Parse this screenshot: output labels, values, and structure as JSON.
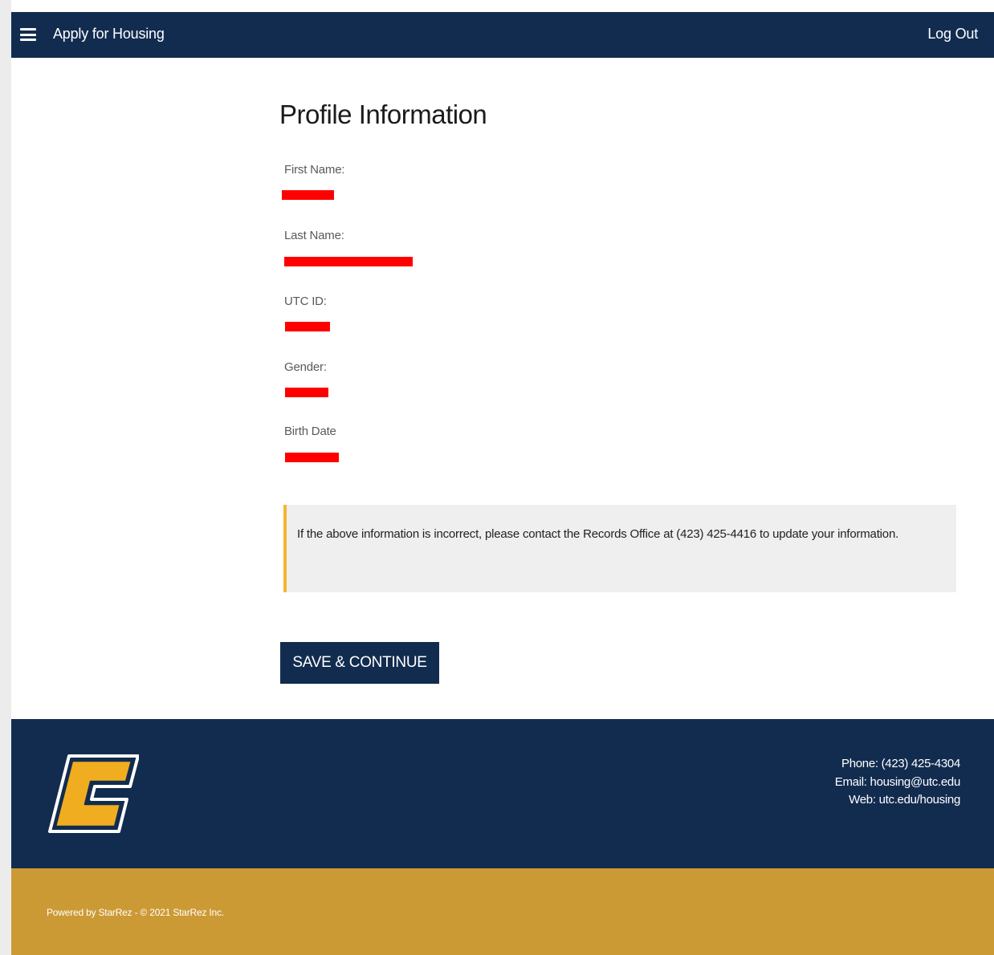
{
  "header": {
    "app_title": "Apply for Housing",
    "logout_label": "Log Out",
    "menu_icon": "hamburger-menu-icon"
  },
  "main": {
    "title": "Profile Information",
    "fields": [
      {
        "label": "First Name:"
      },
      {
        "label": "Last Name:"
      },
      {
        "label": "UTC ID:"
      },
      {
        "label": "Gender:"
      },
      {
        "label": "Birth Date"
      }
    ],
    "notice": "If the above information is incorrect, please contact the Records Office at (423) 425-4416 to update your information.",
    "save_button_label": "SAVE & CONTINUE"
  },
  "footer": {
    "logo_icon": "utc-c-logo-icon",
    "phone": "Phone: (423) 425-4304",
    "email": "Email: housing@utc.edu",
    "web": "Web: utc.edu/housing",
    "powered_by": "Powered by StarRez - © 2021 StarRez Inc."
  },
  "colors": {
    "navy": "#122c4f",
    "gold": "#cc9a35",
    "notice_accent": "#f5b533",
    "redaction": "#ff0000"
  }
}
